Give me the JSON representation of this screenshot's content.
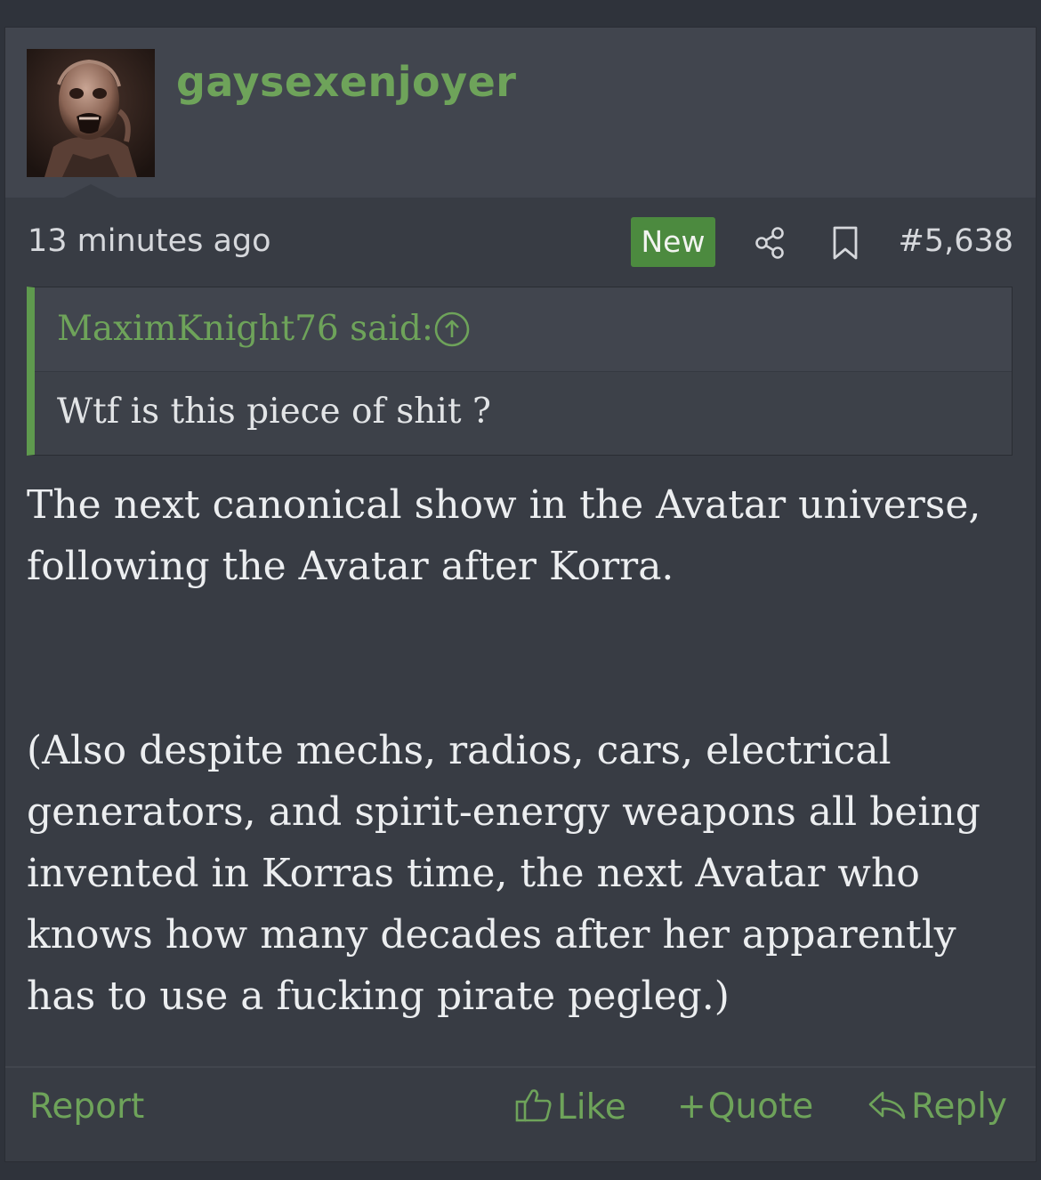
{
  "post": {
    "username": "gaysexenjoyer",
    "timestamp": "13 minutes ago",
    "badge": "New",
    "post_number": "#5,638",
    "quote": {
      "author": "MaximKnight76 said:",
      "text": "Wtf is this piece of shit ?"
    },
    "body": {
      "paragraph1": [
        "The next canonical show in the Avatar universe,",
        "following the Avatar after Korra."
      ],
      "paragraph2": [
        "(Also despite mechs, radios, cars, electrical",
        "generators, and spirit-energy weapons all being",
        "invented in Korras time, the next Avatar who",
        "knows how many decades after her apparently",
        "has to use a fucking pirate pegleg.)"
      ]
    },
    "footer": {
      "report": "Report",
      "like": "Like",
      "quote_plus": "+",
      "quote": "Quote",
      "reply": "Reply"
    },
    "icons": {
      "share": "share-icon",
      "bookmark": "bookmark-icon",
      "quote_arrow": "arrow-up-circle-icon",
      "like": "thumbs-up-icon",
      "reply": "reply-arrow-icon"
    },
    "colors": {
      "accent_green": "#6ea35a",
      "badge_green": "#4c8a3f",
      "background": "#383c44",
      "header_bg": "#41454e"
    }
  }
}
